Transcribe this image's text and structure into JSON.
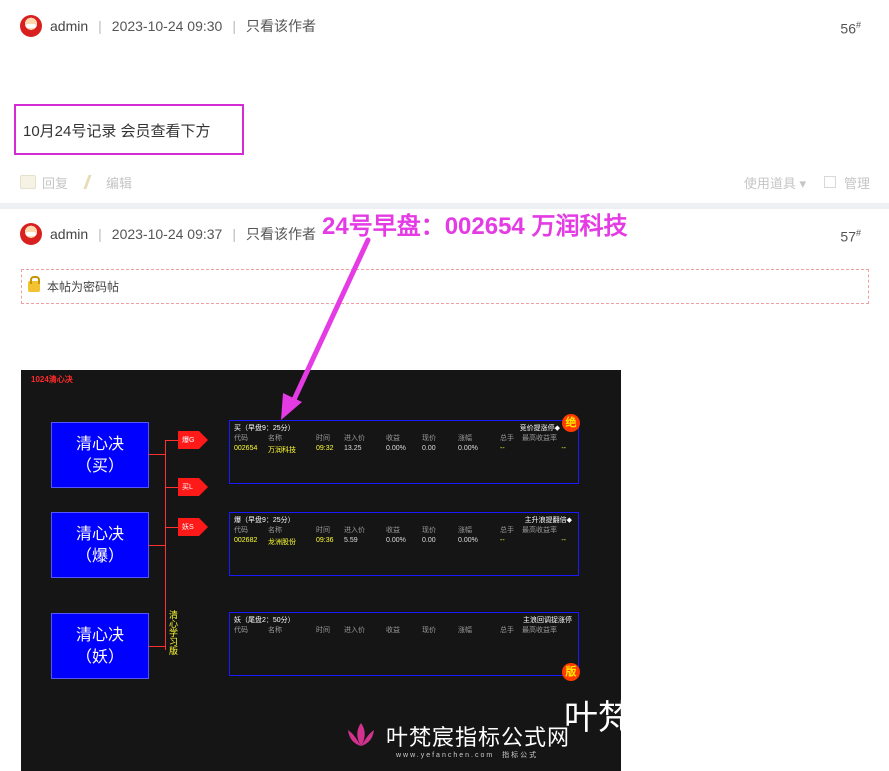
{
  "posts": [
    {
      "author": "admin",
      "datetime": "2023-10-24 09:30",
      "author_only": "只看该作者",
      "floor": "56",
      "floor_mark": "#",
      "content": "10月24号记录  会员查看下方",
      "actions": {
        "reply": "回复",
        "edit": "编辑",
        "tools": "使用道具 ▾",
        "manage": "管理"
      }
    },
    {
      "author": "admin",
      "datetime": "2023-10-24 09:37",
      "author_only": "只看该作者",
      "floor": "57",
      "floor_mark": "#",
      "password_notice": "本帖为密码帖"
    }
  ],
  "annotation": "24号早盘：002654 万润科技",
  "screen": {
    "title": "1024清心决",
    "boxes": [
      {
        "line1": "清心决",
        "line2": "（买）"
      },
      {
        "line1": "清心决",
        "line2": "（爆）"
      },
      {
        "line1": "清心决",
        "line2": "（妖）"
      }
    ],
    "flags": [
      "爆G",
      "买L",
      "妖S"
    ],
    "vertical_label": "清心学习版",
    "panels": [
      {
        "title": "买（早盘9：25分）",
        "right": "竞价提涨停◆",
        "badge": "绝",
        "headers": [
          "代码",
          "名称",
          "时间",
          "进入价",
          "收益",
          "现价",
          "涨幅",
          "总手",
          "最高收益率"
        ],
        "row": [
          "002654",
          "万润科技",
          "09:32",
          "13.25",
          "0.00%",
          "0.00",
          "0.00%",
          "--",
          "--"
        ]
      },
      {
        "title": "爆（早盘9：25分）",
        "right": "主升浪提翻倍◆",
        "badge": "",
        "headers": [
          "代码",
          "名称",
          "时间",
          "进入价",
          "收益",
          "现价",
          "涨幅",
          "总手",
          "最高收益率"
        ],
        "row": [
          "002682",
          "龙洲股份",
          "09:36",
          "5.59",
          "0.00%",
          "0.00",
          "0.00%",
          "--",
          "--"
        ]
      },
      {
        "title": "妖（尾盘2：50分）",
        "right": "主浪回调捉涨停",
        "badge": "版",
        "headers": [
          "代码",
          "名称",
          "时间",
          "进入价",
          "收益",
          "现价",
          "涨幅",
          "总手",
          "最高收益率"
        ],
        "row": []
      }
    ],
    "watermark": {
      "text": "叶梵宸指标公式网",
      "url": "www.yefanchen.com",
      "url_sub": "指标公式",
      "big": "叶梵"
    }
  },
  "colors": {
    "annotation": "#e43be4",
    "highlight_box": "#d42bd4",
    "panel_border": "#1a1aff",
    "box_fill": "#0000ff",
    "row_text": "#ffff33"
  }
}
